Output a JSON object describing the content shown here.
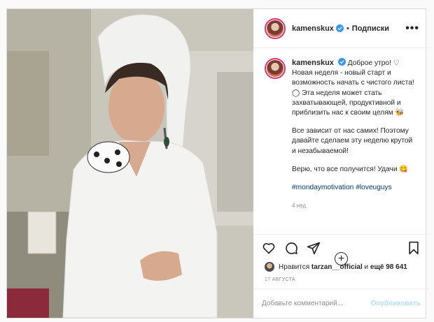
{
  "header": {
    "username": "kamenskux",
    "separator": "•",
    "follow_label": "Подписки",
    "more_label": "•••"
  },
  "caption": {
    "username": "kamenskux",
    "line1": "Доброе утро! ♡ Новая неделя - новый старт и возможность начать с чистого листа! ◯ Эта неделя может стать захватывающей, продуктивной и приблизить нас к своим целям 🐝",
    "line2": "Все зависит от нас самих! Поэтому давайте сделаем эту неделю крутой и незабываемой!",
    "line3": "Верю, что все получится! Удачи 😋",
    "hashtag1": "#mondaymotivation",
    "hashtag2": "#loveuguys",
    "time_ago": "4 нед.",
    "plus_label": "+"
  },
  "likes": {
    "prefix": "Нравится",
    "user": "tarzan__official",
    "middle": "и",
    "count": "ещё 98 641"
  },
  "date": "17 АВГУСТА",
  "comment": {
    "placeholder": "Добавьте комментарий...",
    "post_label": "Опубликовать"
  },
  "icons": [
    "heart-icon",
    "comment-icon",
    "share-icon",
    "bookmark-icon",
    "verified-icon",
    "add-icon"
  ],
  "colors": {
    "hashtag": "#00376b",
    "muted": "#8e8e8e",
    "post_disabled": "#b2dffc",
    "verified": "#3897f0"
  }
}
